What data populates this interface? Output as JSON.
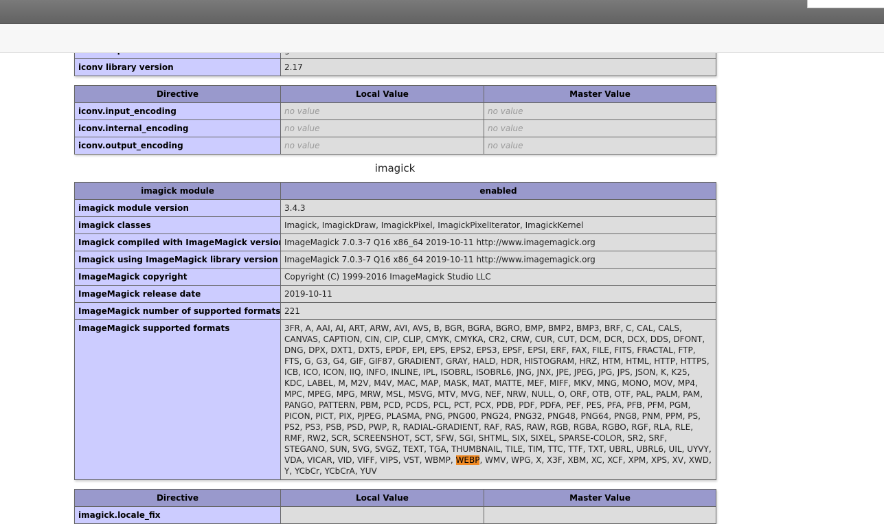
{
  "iconv_top": [
    {
      "name": "iconv implementation",
      "value": "glibc"
    },
    {
      "name": "iconv library version",
      "value": "2.17"
    }
  ],
  "iconv_directives": {
    "headers": [
      "Directive",
      "Local Value",
      "Master Value"
    ],
    "rows": [
      {
        "name": "iconv.input_encoding",
        "local": "no value",
        "master": "no value"
      },
      {
        "name": "iconv.internal_encoding",
        "local": "no value",
        "master": "no value"
      },
      {
        "name": "iconv.output_encoding",
        "local": "no value",
        "master": "no value"
      }
    ]
  },
  "imagick": {
    "title": "imagick",
    "header": [
      "imagick module",
      "enabled"
    ],
    "rows": [
      {
        "name": "imagick module version",
        "value": "3.4.3"
      },
      {
        "name": "imagick classes",
        "value": "Imagick, ImagickDraw, ImagickPixel, ImagickPixelIterator, ImagickKernel"
      },
      {
        "name": "Imagick compiled with ImageMagick version",
        "value": "ImageMagick 7.0.3-7 Q16 x86_64 2019-10-11 http://www.imagemagick.org"
      },
      {
        "name": "Imagick using ImageMagick library version",
        "value": "ImageMagick 7.0.3-7 Q16 x86_64 2019-10-11 http://www.imagemagick.org"
      },
      {
        "name": "ImageMagick copyright",
        "value": "Copyright (C) 1999-2016 ImageMagick Studio LLC"
      },
      {
        "name": "ImageMagick release date",
        "value": "2019-10-11"
      },
      {
        "name": "ImageMagick number of supported formats:",
        "value": "221"
      }
    ],
    "formats_label": "ImageMagick supported formats",
    "formats_before": "3FR, A, AAI, AI, ART, ARW, AVI, AVS, B, BGR, BGRA, BGRO, BMP, BMP2, BMP3, BRF, C, CAL, CALS, CANVAS, CAPTION, CIN, CIP, CLIP, CMYK, CMYKA, CR2, CRW, CUR, CUT, DCM, DCR, DCX, DDS, DFONT, DNG, DPX, DXT1, DXT5, EPDF, EPI, EPS, EPS2, EPS3, EPSF, EPSI, ERF, FAX, FILE, FITS, FRACTAL, FTP, FTS, G, G3, G4, GIF, GIF87, GRADIENT, GRAY, HALD, HDR, HISTOGRAM, HRZ, HTM, HTML, HTTP, HTTPS, ICB, ICO, ICON, IIQ, INFO, INLINE, IPL, ISOBRL, ISOBRL6, JNG, JNX, JPE, JPEG, JPG, JPS, JSON, K, K25, KDC, LABEL, M, M2V, M4V, MAC, MAP, MASK, MAT, MATTE, MEF, MIFF, MKV, MNG, MONO, MOV, MP4, MPC, MPEG, MPG, MRW, MSL, MSVG, MTV, MVG, NEF, NRW, NULL, O, ORF, OTB, OTF, PAL, PALM, PAM, PANGO, PATTERN, PBM, PCD, PCDS, PCL, PCT, PCX, PDB, PDF, PDFA, PEF, PES, PFA, PFB, PFM, PGM, PICON, PICT, PIX, PJPEG, PLASMA, PNG, PNG00, PNG24, PNG32, PNG48, PNG64, PNG8, PNM, PPM, PS, PS2, PS3, PSB, PSD, PWP, R, RADIAL-GRADIENT, RAF, RAS, RAW, RGB, RGBA, RGBO, RGF, RLA, RLE, RMF, RW2, SCR, SCREENSHOT, SCT, SFW, SGI, SHTML, SIX, SIXEL, SPARSE-COLOR, SR2, SRF, STEGANO, SUN, SVG, SVGZ, TEXT, TGA, THUMBNAIL, TILE, TIM, TTC, TTF, TXT, UBRL, UBRL6, UIL, UYVY, VDA, VICAR, VID, VIFF, VIPS, VST, WBMP, ",
    "formats_highlight": "WEBP",
    "formats_after": ", WMV, WPG, X, X3F, XBM, XC, XCF, XPM, XPS, XV, XWD, Y, YCbCr, YCbCrA, YUV"
  },
  "imagick_directives": {
    "headers": [
      "Directive",
      "Local Value",
      "Master Value"
    ],
    "first_row_name": "imagick.locale_fix"
  },
  "colors": {
    "header_bg": "#9999cc",
    "label_bg": "#ccccff",
    "value_bg": "#dddddd",
    "highlight": "#f08a24"
  }
}
